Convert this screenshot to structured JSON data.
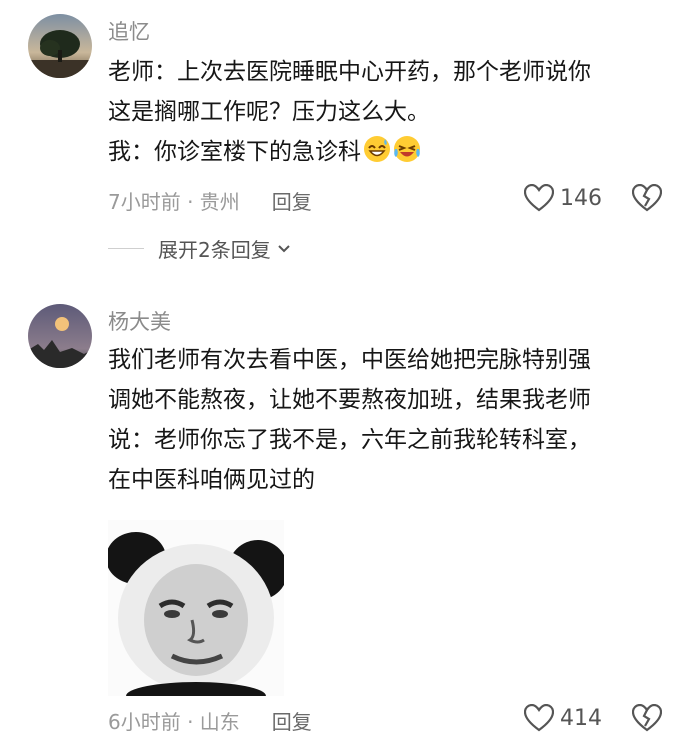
{
  "comments": [
    {
      "username": "追忆",
      "lines": [
        "老师：上次去医院睡眠中心开药，那个老师说你",
        "这是搁哪工作呢？压力这么大。",
        "我：你诊室楼下的急诊科"
      ],
      "emojis": [
        "grin-sweat-emoji",
        "laugh-cry-emoji"
      ],
      "time_location": "7小时前 · 贵州",
      "reply_label": "回复",
      "like_count": "146",
      "expand_label": "展开2条回复"
    },
    {
      "username": "杨大美",
      "lines": [
        "我们老师有次去看中医，中医给她把完脉特别强",
        "调她不能熬夜，让她不要熬夜加班，结果我老师",
        "说：老师你忘了我不是，六年之前我轮转科室，",
        "在中医科咱俩见过的"
      ],
      "sticker": "panda-face-meme-sticker",
      "time_location": "6小时前 · 山东",
      "reply_label": "回复",
      "like_count": "414"
    }
  ],
  "colors": {
    "text": "#161616",
    "meta": "#9a9a9a",
    "username": "#8b8b8b"
  }
}
